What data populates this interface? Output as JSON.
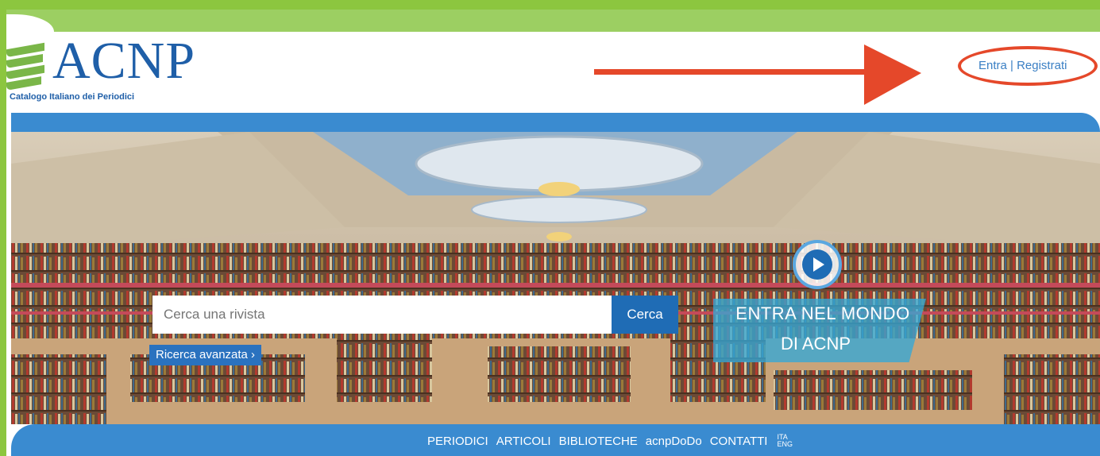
{
  "header": {
    "logo_text": "ACNP",
    "logo_subtitle": "Catalogo Italiano dei Periodici"
  },
  "login": {
    "label": "Entra | Registrati"
  },
  "search": {
    "placeholder": "Cerca una rivista",
    "button_label": "Cerca",
    "advanced_label": "Ricerca avanzata ›"
  },
  "promo": {
    "line1": "ENTRA NEL MONDO",
    "line2": "DI ACNP"
  },
  "nav": {
    "items": [
      "PERIODICI",
      "ARTICOLI",
      "BIBLIOTECHE",
      "acnpDoDo",
      "CONTATTI"
    ],
    "lang_ita": "ITA",
    "lang_eng": "ENG"
  },
  "colors": {
    "frame": "#8cc63f",
    "primary": "#3a8bd0",
    "brand": "#1f5fa8",
    "annotation": "#e5482a"
  },
  "icons": {
    "play": "play-icon",
    "arrow": "arrow-right-icon"
  }
}
